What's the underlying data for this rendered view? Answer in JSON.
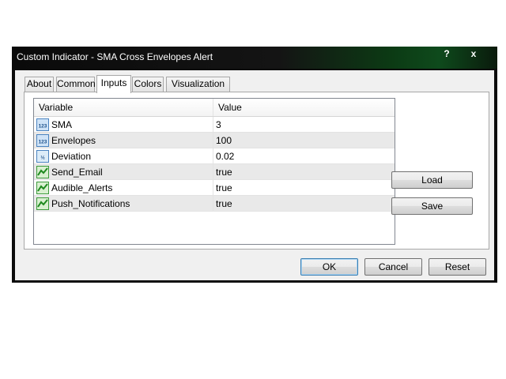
{
  "window": {
    "title": "Custom Indicator - SMA Cross Envelopes Alert",
    "help_label": "?",
    "close_label": "x"
  },
  "tabs": [
    {
      "label": "About",
      "active": false
    },
    {
      "label": "Common",
      "active": false
    },
    {
      "label": "Inputs",
      "active": true
    },
    {
      "label": "Colors",
      "active": false
    },
    {
      "label": "Visualization",
      "active": false
    }
  ],
  "inputs_table": {
    "columns": [
      "Variable",
      "Value"
    ],
    "rows": [
      {
        "name": "SMA",
        "value": "3",
        "icon": "integer-icon",
        "icon_text": "123"
      },
      {
        "name": "Envelopes",
        "value": "100",
        "icon": "integer-icon",
        "icon_text": "123"
      },
      {
        "name": "Deviation",
        "value": "0.02",
        "icon": "double-icon",
        "icon_text": "½"
      },
      {
        "name": "Send_Email",
        "value": "true",
        "icon": "bool-icon"
      },
      {
        "name": "Audible_Alerts",
        "value": "true",
        "icon": "bool-icon"
      },
      {
        "name": "Push_Notifications",
        "value": "true",
        "icon": "bool-icon"
      }
    ]
  },
  "side_buttons": {
    "load_label": "Load",
    "save_label": "Save"
  },
  "footer_buttons": {
    "ok_label": "OK",
    "cancel_label": "Cancel",
    "reset_label": "Reset"
  },
  "colors": {
    "accent_green": "#0e4a1c",
    "default_button_border": "#3c7fb1"
  }
}
